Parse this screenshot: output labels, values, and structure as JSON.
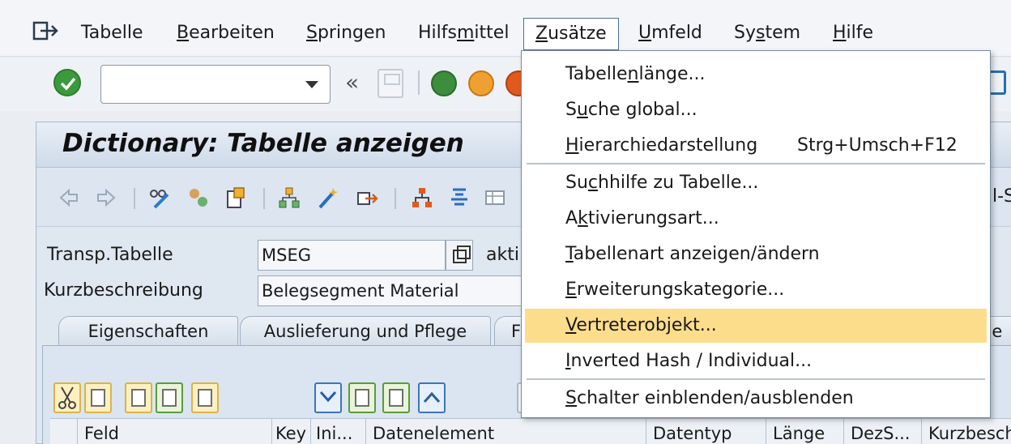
{
  "menubar": {
    "items": [
      {
        "label": "Tabelle",
        "u": ""
      },
      {
        "pre": "",
        "u": "B",
        "post": "earbeiten"
      },
      {
        "pre": "",
        "u": "S",
        "post": "pringen"
      },
      {
        "pre": "Hilfs",
        "u": "m",
        "post": "ittel"
      },
      {
        "pre": "",
        "u": "Z",
        "post": "usätze"
      },
      {
        "pre": "",
        "u": "U",
        "post": "mfeld"
      },
      {
        "pre": "Sy",
        "u": "s",
        "post": "tem"
      },
      {
        "pre": "",
        "u": "H",
        "post": "ilfe"
      }
    ]
  },
  "toolbar": {
    "command_value": "",
    "nav_back": "«"
  },
  "screen": {
    "title": "Dictionary: Tabelle anzeigen",
    "right_fragment": "l-S"
  },
  "form": {
    "table_label": "Transp.Tabelle",
    "table_value": "MSEG",
    "status_fragment": "akti",
    "desc_label": "Kurzbeschreibung",
    "desc_value": "Belegsegment Material"
  },
  "tabs": [
    {
      "label": "Eigenschaften"
    },
    {
      "label": "Auslieferung und Pflege"
    },
    {
      "label": "F"
    },
    {
      "label": "ge"
    }
  ],
  "columns": [
    {
      "label": "Feld"
    },
    {
      "label": "Key"
    },
    {
      "label": "Ini..."
    },
    {
      "label": "Datenelement"
    },
    {
      "label": "Datentyp"
    },
    {
      "label": "Länge"
    },
    {
      "label": "DezS..."
    },
    {
      "label": "Kurzbesch"
    }
  ],
  "dropdown": {
    "items": [
      {
        "pre": "Tabelle",
        "u": "n",
        "post": "länge...",
        "shortcut": ""
      },
      {
        "pre": "S",
        "u": "u",
        "post": "che global...",
        "shortcut": ""
      },
      {
        "pre": "",
        "u": "H",
        "post": "ierarchiedarstellung",
        "shortcut": "Strg+Umsch+F12"
      },
      {
        "pre": "Su",
        "u": "c",
        "post": "hhilfe zu Tabelle...",
        "shortcut": ""
      },
      {
        "pre": "A",
        "u": "k",
        "post": "tivierungsart...",
        "shortcut": ""
      },
      {
        "pre": "",
        "u": "T",
        "post": "abellenart anzeigen/ändern",
        "shortcut": ""
      },
      {
        "pre": "",
        "u": "E",
        "post": "rweiterungskategorie...",
        "shortcut": ""
      },
      {
        "pre": "",
        "u": "V",
        "post": "ertreterobjekt...",
        "shortcut": ""
      },
      {
        "pre": "",
        "u": "I",
        "post": "nverted Hash / Individual...",
        "shortcut": ""
      },
      {
        "pre": "",
        "u": "S",
        "post": "chalter einblenden/ausblenden",
        "shortcut": ""
      }
    ]
  },
  "colors": {
    "highlight": "#fcdd8c",
    "accent": "#4a6f9a",
    "ok": "#3b9a3b"
  }
}
